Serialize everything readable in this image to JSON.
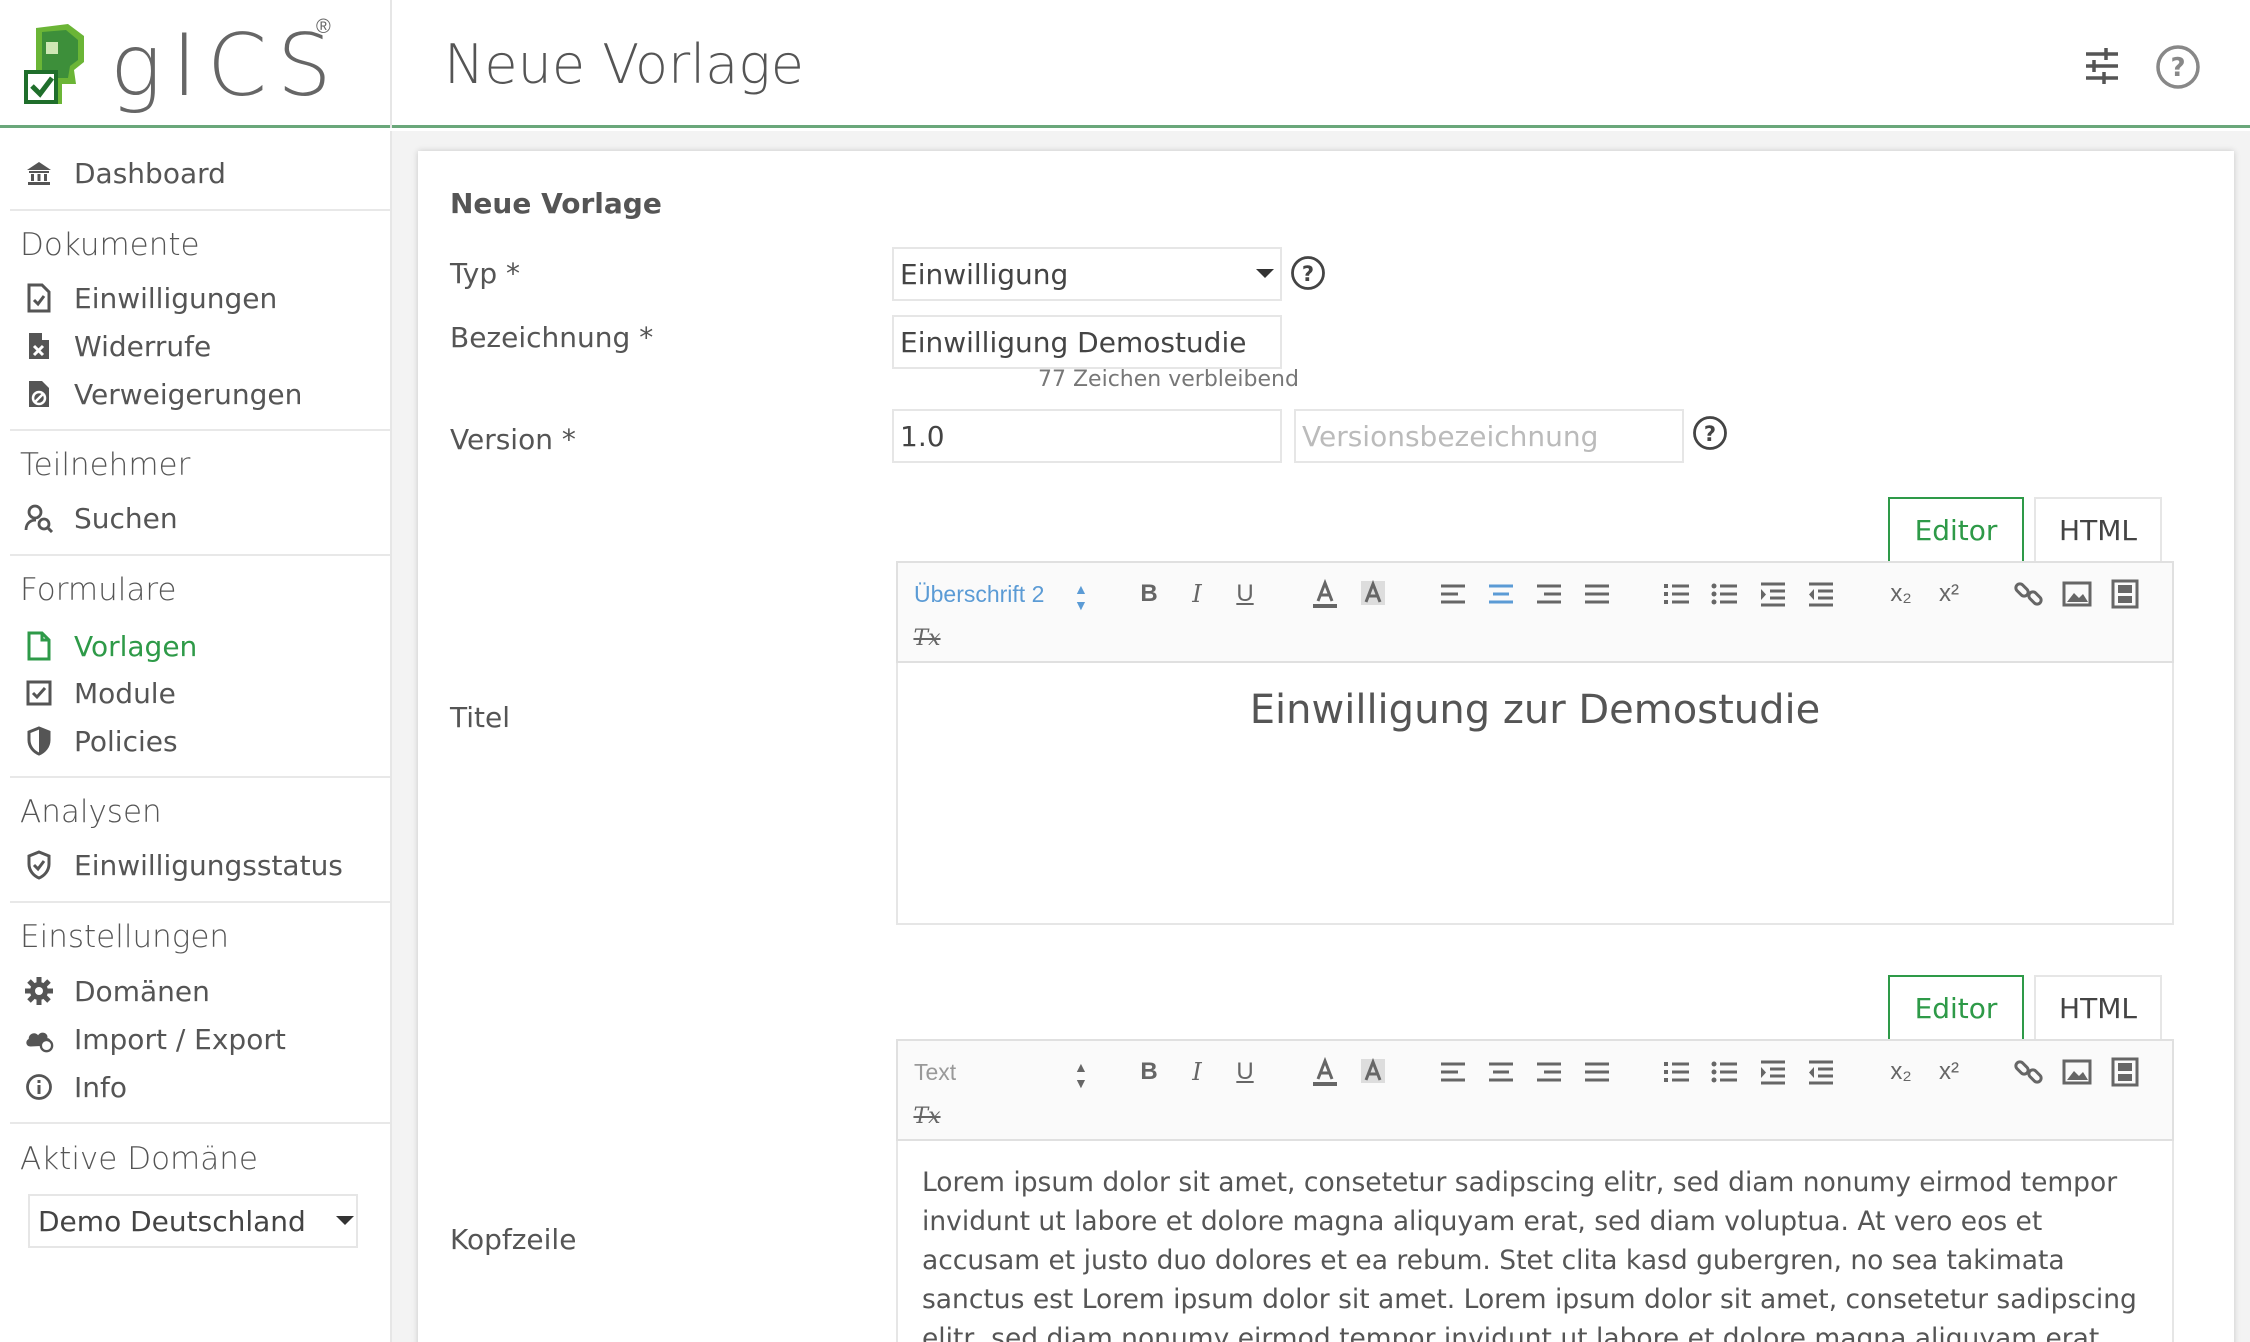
{
  "app": {
    "logo_text": "gICS",
    "logo_reg": "®",
    "page_title": "Neue Vorlage"
  },
  "header": {
    "settings_icon": "sliders-icon",
    "help_icon": "help-circle-icon"
  },
  "sidebar": {
    "dashboard": "Dashboard",
    "sections": [
      {
        "title": "Dokumente",
        "items": [
          "Einwilligungen",
          "Widerrufe",
          "Verweigerungen"
        ]
      },
      {
        "title": "Teilnehmer",
        "items": [
          "Suchen"
        ]
      },
      {
        "title": "Formulare",
        "items": [
          "Vorlagen",
          "Module",
          "Policies"
        ]
      },
      {
        "title": "Analysen",
        "items": [
          "Einwilligungsstatus"
        ]
      },
      {
        "title": "Einstellungen",
        "items": [
          "Domänen",
          "Import / Export",
          "Info"
        ]
      },
      {
        "title": "Aktive Domäne",
        "items": []
      }
    ],
    "active_item": "Vorlagen",
    "active_domain": "Demo Deutschland"
  },
  "form": {
    "card_title": "Neue Vorlage",
    "typ_label": "Typ  *",
    "typ_value": "Einwilligung",
    "bezeichnung_label": "Bezeichnung  *",
    "bezeichnung_value": "Einwilligung Demostudie",
    "bezeichnung_helper": "77 Zeichen verbleibend",
    "version_label": "Version  *",
    "version_value": "1.0",
    "versionsbezeichnung_placeholder": "Versionsbezeichnung",
    "titel_label": "Titel",
    "kopfzeile_label": "Kopfzeile"
  },
  "editor_titel": {
    "tabs": [
      "Editor",
      "HTML"
    ],
    "style_select": "Überschrift 2",
    "content": "Einwilligung zur Demostudie"
  },
  "editor_kopfzeile": {
    "tabs": [
      "Editor",
      "HTML"
    ],
    "style_select": "Text",
    "content": "Lorem ipsum dolor sit amet, consetetur sadipscing elitr, sed diam nonumy eirmod tempor invidunt ut labore et dolore magna aliquyam erat, sed diam voluptua. At vero eos et accusam et justo duo dolores et ea rebum. Stet clita kasd gubergren, no sea takimata sanctus est Lorem ipsum dolor sit amet. Lorem ipsum dolor sit amet, consetetur sadipscing elitr, sed diam nonumy eirmod tempor invidunt ut labore et dolore magna aliquyam erat, sed diam voluptua. At vero"
  },
  "toolbar_buttons": {
    "bold": "B",
    "italic": "I",
    "underline": "U",
    "subscript": "x₂",
    "superscript": "x²",
    "clear_format": "Tx"
  },
  "colors": {
    "accent": "#2e9a48",
    "select_blue": "#5b9bd5"
  }
}
